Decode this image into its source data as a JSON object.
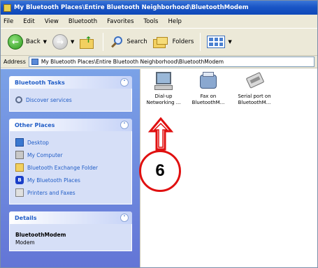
{
  "window": {
    "title": "My Bluetooth Places\\Entire Bluetooth Neighborhood\\BluetoothModem"
  },
  "menu": {
    "items": [
      "File",
      "Edit",
      "View",
      "Bluetooth",
      "Favorites",
      "Tools",
      "Help"
    ]
  },
  "toolbar": {
    "back_label": "Back",
    "search_label": "Search",
    "folders_label": "Folders"
  },
  "address": {
    "label": "Address",
    "value": "My Bluetooth Places\\Entire Bluetooth Neighborhood\\BluetoothModem"
  },
  "taskpane": {
    "bluetooth_tasks": {
      "title": "Bluetooth Tasks",
      "items": [
        "Discover services"
      ]
    },
    "other_places": {
      "title": "Other Places",
      "items": [
        "Desktop",
        "My Computer",
        "Bluetooth Exchange Folder",
        "My Bluetooth Places",
        "Printers and Faxes"
      ]
    },
    "details": {
      "title": "Details",
      "name": "BluetoothModem",
      "type": "Modem"
    }
  },
  "files": [
    {
      "line1": "Dial-up",
      "line2": "Networking ...",
      "icon": "dialup-networking-icon"
    },
    {
      "line1": "Fax on",
      "line2": "BluetoothM...",
      "icon": "fax-icon"
    },
    {
      "line1": "Serial port on",
      "line2": "BluetoothM...",
      "icon": "serial-port-icon"
    }
  ],
  "callout": {
    "number": "6",
    "color": "#e01010"
  },
  "colors": {
    "titlebar": "#1a55c6",
    "taskpane": "#6375d6",
    "link": "#215dc6"
  }
}
